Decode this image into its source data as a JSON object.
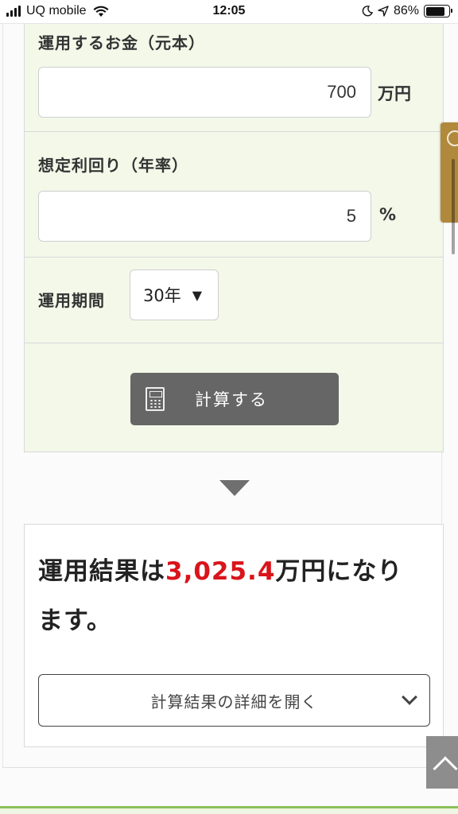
{
  "status_bar": {
    "carrier": "UQ mobile",
    "time": "12:05",
    "battery_percent": "86%"
  },
  "form": {
    "principal": {
      "label": "運用するお金（元本）",
      "value": "700",
      "unit": "万円"
    },
    "yield": {
      "label": "想定利回り（年率）",
      "value": "5",
      "unit": "%"
    },
    "period": {
      "label": "運用期間",
      "selected": "30年"
    },
    "calculate_label": "計算する"
  },
  "result": {
    "prefix": "運用結果は",
    "amount": "3,025.4",
    "suffix": "万円になります。"
  },
  "details_toggle_label": "計算結果の詳細を開く",
  "colors": {
    "form_bg": "#f3f8e9",
    "button_bg": "#666666",
    "result_amount": "#d9141b",
    "side_tab": "#b0893d"
  }
}
